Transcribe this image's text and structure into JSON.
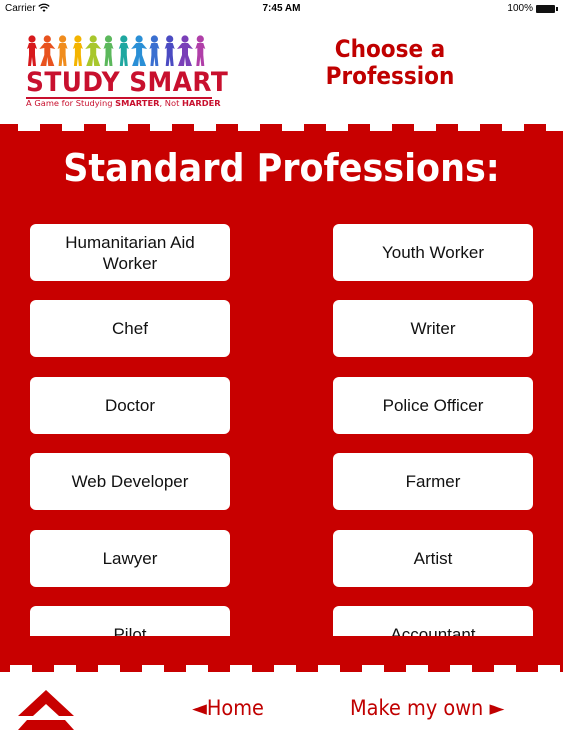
{
  "status_bar": {
    "carrier": "Carrier",
    "time": "7:45 AM",
    "battery": "100%"
  },
  "logo": {
    "title": "STUDY SMART",
    "tagline_pre": "A Game for Studying ",
    "tagline_bold1": "SMARTER",
    "tagline_mid": ", Not ",
    "tagline_bold2": "HARDER",
    "kid_colors": [
      "#d7191c",
      "#e8531f",
      "#f08c1d",
      "#f4b400",
      "#a8c72c",
      "#5cb85c",
      "#1fa7a0",
      "#2a8fd6",
      "#3a6fd0",
      "#4b4bc2",
      "#7a3fb8",
      "#b03fa8"
    ]
  },
  "header": {
    "title_line1": "Choose a",
    "title_line2": "Profession"
  },
  "section": {
    "title": "Standard Professions:"
  },
  "professions": {
    "left": [
      "Humanitarian Aid Worker",
      "Chef",
      "Doctor",
      "Web Developer",
      "Lawyer",
      "Pilot"
    ],
    "right": [
      "Youth Worker",
      "Writer",
      "Police Officer",
      "Farmer",
      "Artist",
      "Accountant"
    ]
  },
  "footer": {
    "up_icon": "double-chevron-up-icon",
    "home_label": "◄Home",
    "make_own_label": "Make my own ►"
  },
  "colors": {
    "brand_red": "#c80000",
    "text_red": "#c00000",
    "button_bg": "#ffffff"
  }
}
